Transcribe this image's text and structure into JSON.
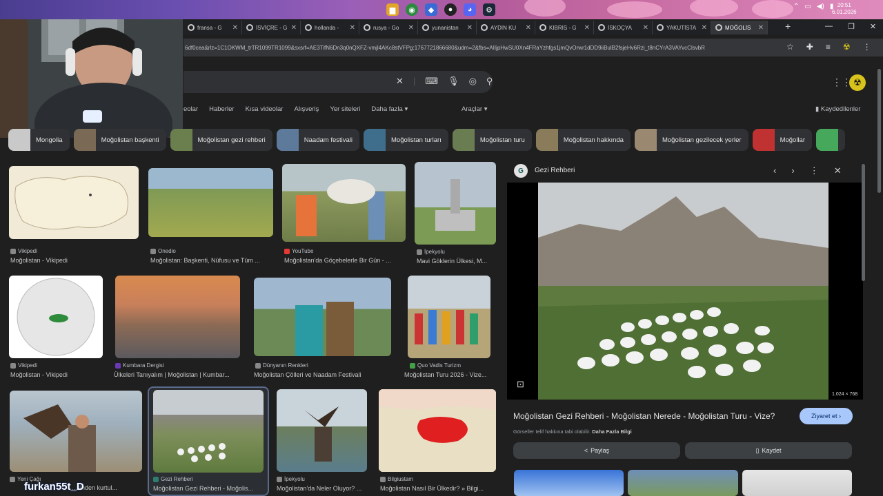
{
  "system": {
    "clock_time": "20:51",
    "clock_date": "6.01.2026"
  },
  "tabs": [
    {
      "label": "fransa - G"
    },
    {
      "label": "İSVİÇRE - G"
    },
    {
      "label": "hollanda -"
    },
    {
      "label": "rusya - Go"
    },
    {
      "label": "yunanistan"
    },
    {
      "label": "AYDIN KU"
    },
    {
      "label": "KIBRIS - G"
    },
    {
      "label": "İSKOÇYA"
    },
    {
      "label": "YAKUTİSTA"
    },
    {
      "label": "MOĞOLİS",
      "active": true
    }
  ],
  "address_bar": {
    "url": "6df0cea&rlz=1C1OKWM_trTR1099TR1099&sxsrf=AE3TifN6Dn3q0nQXFZ-vmjl4AKc8stVFPg:1767721866680&udm=2&fbs=AIIjpHwSU0Xn4FRaYzhfgs1jmQvOrwr1dDD9iiBulB2fsjeHv6Rzi_t8nCYrA3VAYvcClsvbR"
  },
  "search": {
    "placeholder": ""
  },
  "filters": [
    "eolar",
    "Haberler",
    "Kısa videolar",
    "Alışveriş",
    "Yer siteleri",
    "Daha fazla ▾"
  ],
  "tools_label": "Araçlar ▾",
  "saved_label": "Kaydedilenler",
  "chips": [
    {
      "label": "Mongolia",
      "color": "#c9c9c9"
    },
    {
      "label": "Moğolistan başkenti",
      "color": "#7a6a55"
    },
    {
      "label": "Moğolistan gezi rehberi",
      "color": "#6b7f4e"
    },
    {
      "label": "Naadam festivali",
      "color": "#5e7a9a"
    },
    {
      "label": "Moğolistan turları",
      "color": "#3f6e8c"
    },
    {
      "label": "Moğolistan turu",
      "color": "#6a7d52"
    },
    {
      "label": "Moğolistan hakkında",
      "color": "#8a7b5a"
    },
    {
      "label": "Moğolistan gezilecek yerler",
      "color": "#9a8870"
    },
    {
      "label": "Moğollar",
      "color": "#c03232"
    },
    {
      "label": "",
      "color": "#46a85a"
    }
  ],
  "results": [
    {
      "source": "Vikipedi",
      "title": "Moğolistan - Vikipedi"
    },
    {
      "source": "Onedio",
      "title": "Moğolistan: Başkenti, Nüfusu ve Tüm ..."
    },
    {
      "source": "YouTube",
      "title": "Moğolistan'da Göçebelerle Bir Gün - ..."
    },
    {
      "source": "İpekyolu",
      "title": "Mavi Göklerin Ülkesi, M..."
    },
    {
      "source": "Vikipedi",
      "title": "Moğolistan - Vikipedi"
    },
    {
      "source": "Kumbara Dergisi",
      "title": "Ülkeleri Tanıyalım | Moğolistan | Kumbar..."
    },
    {
      "source": "Dünyanın Renkleri",
      "title": "Moğolistan Çölleri ve Naadam Festivali"
    },
    {
      "source": "Quo Vadis Turizm",
      "title": "Moğolistan Turu 2026 - Vize..."
    },
    {
      "source": "Yeni Çağı",
      "title": "...sinden kurtul..."
    },
    {
      "source": "Gezi Rehberi",
      "title": "Moğolistan Gezi Rehberi - Moğolis..."
    },
    {
      "source": "İpekyolu",
      "title": "Moğolistan'da Neler Oluyor? ..."
    },
    {
      "source": "Bilgiustam",
      "title": "Moğolistan Nasıl Bir Ülkedir? » Bilgi..."
    }
  ],
  "preview": {
    "site_name": "Gezi Rehberi",
    "dimensions": "1.024 × 768",
    "title": "Moğolistan Gezi Rehberi - Moğolistan Nerede - Moğolistan Turu - Vize?",
    "visit_label": "Ziyaret et",
    "note_text": "Görseller telif hakkına tabi olabilir.",
    "note_link": "Daha Fazla Bilgi",
    "share_label": "Paylaş",
    "save_label": "Kaydet"
  },
  "overlay_text": "furkan55t_D"
}
